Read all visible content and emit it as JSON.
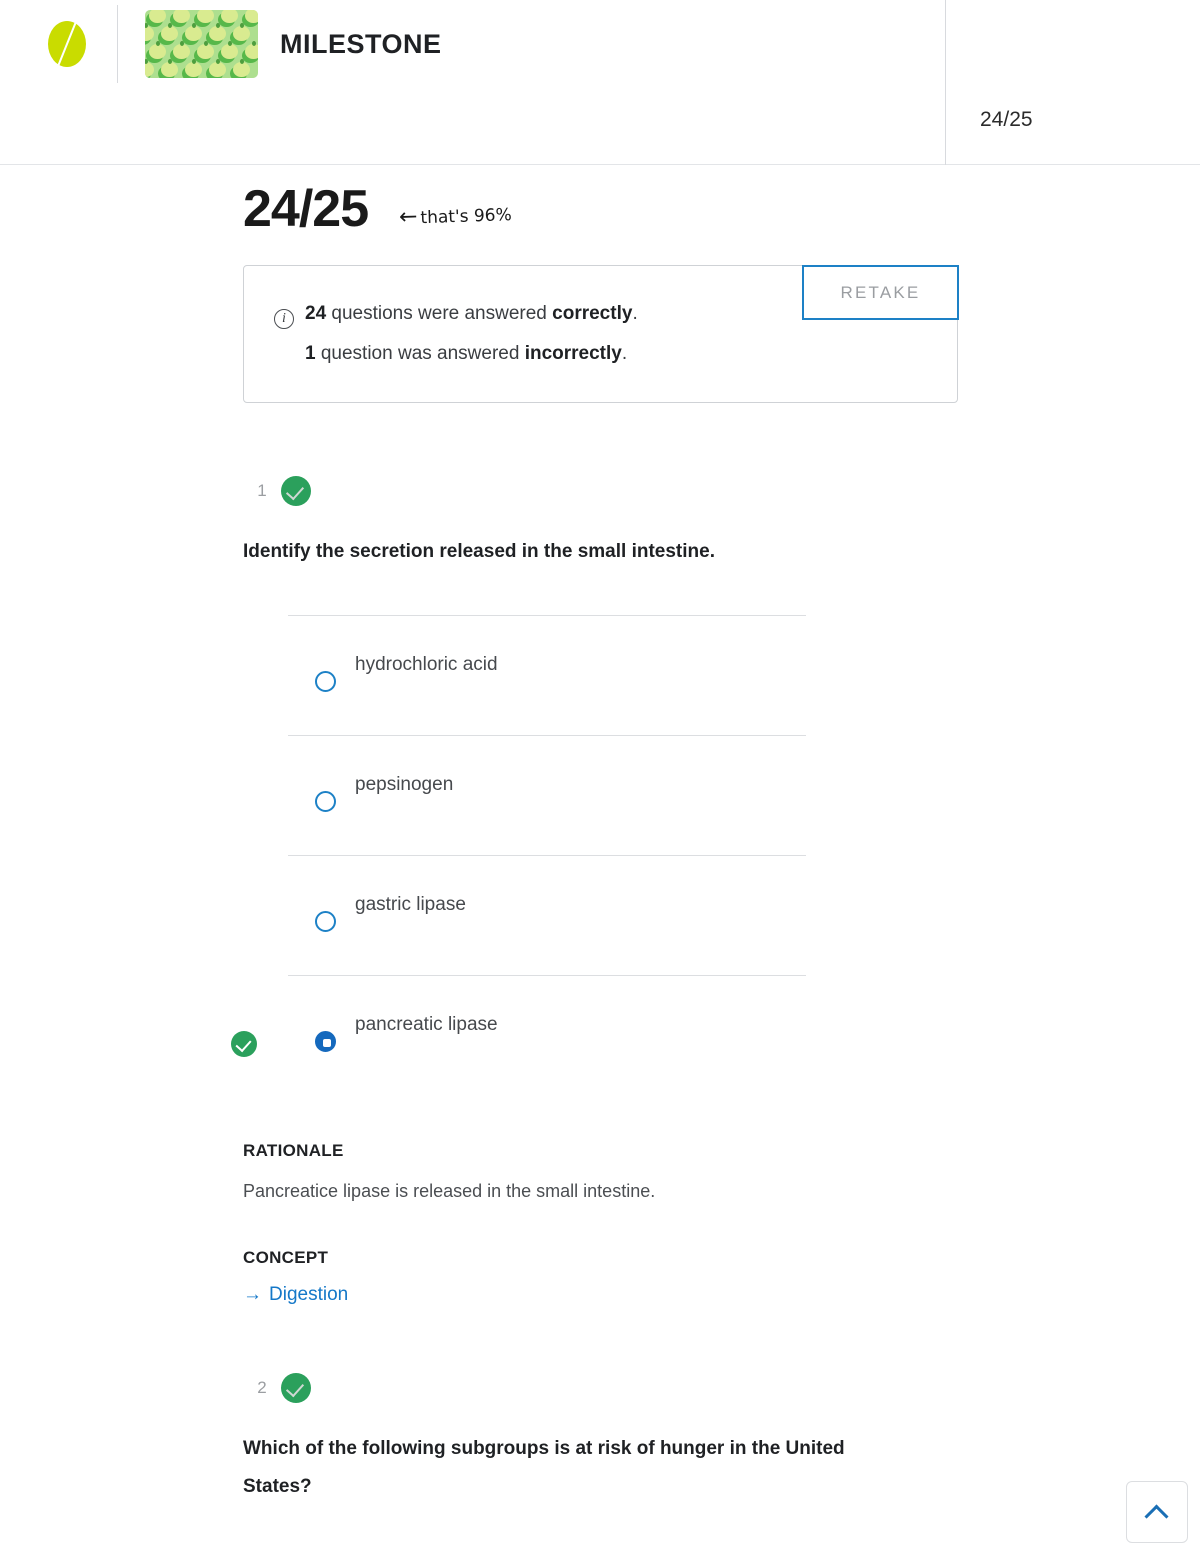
{
  "header": {
    "logo_name": "sophia-logo",
    "course_thumbnail_alt": "green-apples-pattern",
    "title": "MILESTONE",
    "score_badge": "24/25"
  },
  "score_section": {
    "score": "24/25",
    "annotation": "that's 96%",
    "annotation_arrow": "←",
    "retake_label": "RETAKE"
  },
  "summary": {
    "icon": "info-icon",
    "correct_count": "24",
    "correct_text_before": " questions were answered ",
    "correct_word": "correctly",
    "correct_period": ".",
    "incorrect_count": "1",
    "incorrect_text_before": " question was answered ",
    "incorrect_word": "incorrectly",
    "incorrect_period": "."
  },
  "questions": [
    {
      "number": "1",
      "status": "correct",
      "text": "Identify the secretion released in the small intestine.",
      "options": [
        {
          "label": "hydrochloric acid",
          "selected": false,
          "correct": false
        },
        {
          "label": "pepsinogen",
          "selected": false,
          "correct": false
        },
        {
          "label": "gastric lipase",
          "selected": false,
          "correct": false
        },
        {
          "label": "pancreatic lipase",
          "selected": true,
          "correct": true
        }
      ],
      "rationale_title": "RATIONALE",
      "rationale_body": "Pancreatice lipase is released in the small intestine.",
      "concept_title": "CONCEPT",
      "concept_link": "Digestion",
      "concept_arrow": "→"
    },
    {
      "number": "2",
      "status": "correct",
      "text": "Which of the following subgroups is at risk of hunger in the United States?"
    }
  ],
  "scroll_top": {
    "icon": "chevron-up-icon"
  },
  "colors": {
    "brand_green": "#c9dc00",
    "accent_blue": "#1d81c6",
    "link_blue": "#1578c8",
    "correct_green": "#2ba05c",
    "thumb_bg": "#addf8f"
  }
}
